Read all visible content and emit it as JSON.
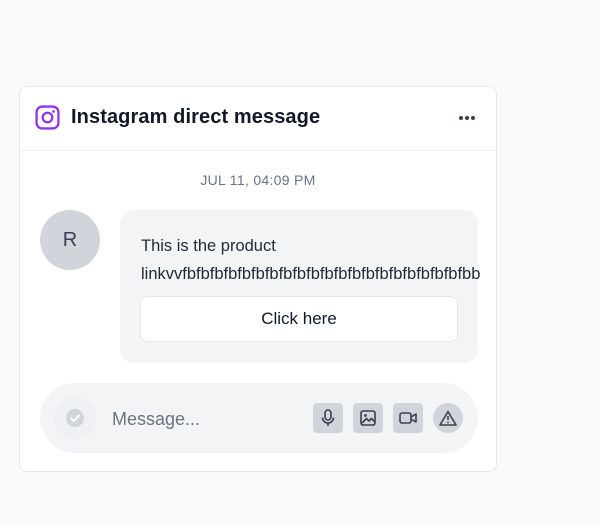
{
  "header": {
    "title": "Instagram direct message",
    "icon": "instagram-icon",
    "more_icon": "more-horizontal-icon",
    "accent_color": "#9333ea"
  },
  "thread": {
    "timestamp": "JUL 11, 04:09 PM",
    "avatar_initial": "R",
    "message_line1": "This is the product",
    "message_line2": "linkvvfbfbfbfbfbfbfbfbfbfbfbfbfbfbfbfbfbfbfbfbfbb",
    "cta_label": "Click here"
  },
  "composer": {
    "placeholder": "Message...",
    "tools": [
      "microphone-icon",
      "image-icon",
      "video-icon",
      "alert-triangle-icon"
    ]
  }
}
